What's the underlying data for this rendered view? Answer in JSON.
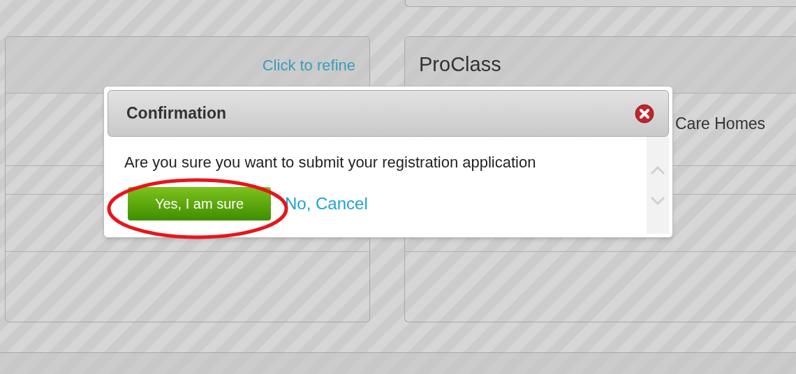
{
  "left_panel": {
    "refine_link": "Click to refine"
  },
  "right_panel": {
    "title": "ProClass",
    "row_text": "Care Homes"
  },
  "dialog": {
    "title": "Confirmation",
    "message": "Are you sure you want to submit your registration application",
    "confirm_button": "Yes, I am sure",
    "cancel_link": "No, Cancel"
  }
}
